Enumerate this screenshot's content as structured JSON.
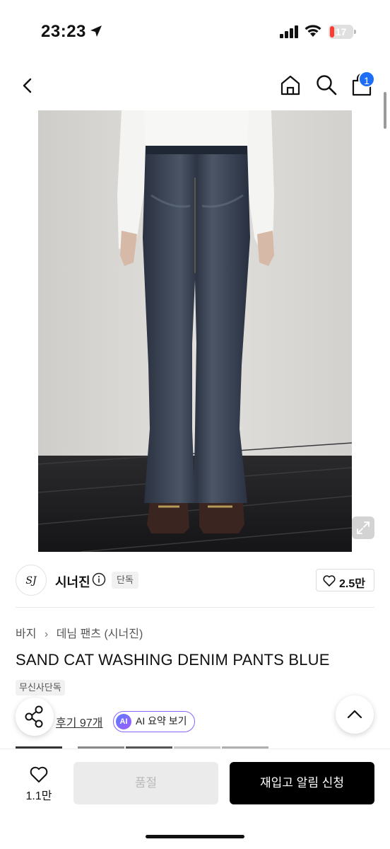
{
  "status_bar": {
    "time": "23:23",
    "battery": "17",
    "battery_level": 0.17,
    "battery_color": "#ff3b30"
  },
  "nav": {
    "back_icon": "chevron-left-icon",
    "home_icon": "home-icon",
    "search_icon": "search-icon",
    "cart_icon": "shopping-bag-icon",
    "cart_count": "1",
    "badge_color": "#1e6df6"
  },
  "brand": {
    "logo_text": "SJ",
    "name": "시너진",
    "exclusive": "단독",
    "likes": "2.5만"
  },
  "breadcrumb": [
    "바지",
    "데님 팬츠 (시너진)"
  ],
  "product": {
    "title": "SAND CAT WASHING DENIM PANTS BLUE",
    "tag": "무신사단독"
  },
  "reviews": {
    "label": "후기 97개",
    "ai_badge": "AI",
    "ai_label": "AI 요약 보기"
  },
  "bottom": {
    "wish_count": "1.1만",
    "soldout_label": "품절",
    "restock_label": "재입고 알림 신청"
  },
  "colors": {
    "primary_button": "#000000",
    "disabled_button": "#ebebeb",
    "ai_accent": "#8a63ff"
  }
}
